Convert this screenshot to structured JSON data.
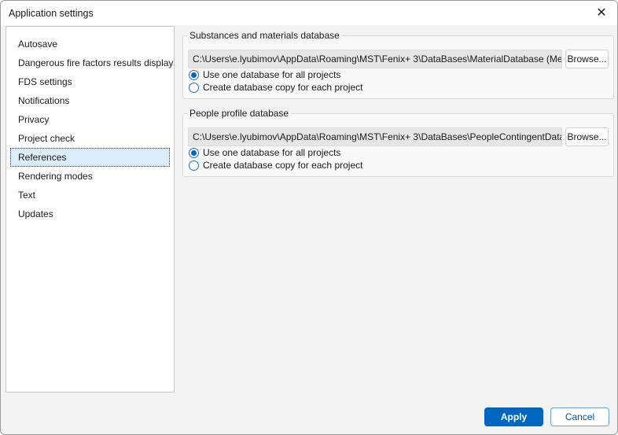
{
  "window": {
    "title": "Application settings"
  },
  "sidebar": {
    "selected": "References",
    "items": [
      {
        "label": "Autosave"
      },
      {
        "label": "Dangerous fire factors results display"
      },
      {
        "label": "FDS settings"
      },
      {
        "label": "Notifications"
      },
      {
        "label": "Privacy"
      },
      {
        "label": "Project check"
      },
      {
        "label": "References"
      },
      {
        "label": "Rendering modes"
      },
      {
        "label": "Text"
      },
      {
        "label": "Updates"
      }
    ]
  },
  "groups": [
    {
      "title": "Substances and materials database",
      "path": "C:\\Users\\e.lyubimov\\AppData\\Roaming\\MST\\Fenix+ 3\\DataBases\\MaterialDatabase (Me",
      "browse": "Browse...",
      "options": [
        "Use one database for all projects",
        "Create database copy for each project"
      ],
      "selected": 0
    },
    {
      "title": "People profile database",
      "path": "C:\\Users\\e.lyubimov\\AppData\\Roaming\\MST\\Fenix+ 3\\DataBases\\PeopleContingentData",
      "browse": "Browse...",
      "options": [
        "Use one database for all projects",
        "Create database copy for each project"
      ],
      "selected": 0
    }
  ],
  "footer": {
    "apply": "Apply",
    "cancel": "Cancel"
  },
  "colors": {
    "accent": "#0067c0",
    "selection": "#dcedfc"
  }
}
